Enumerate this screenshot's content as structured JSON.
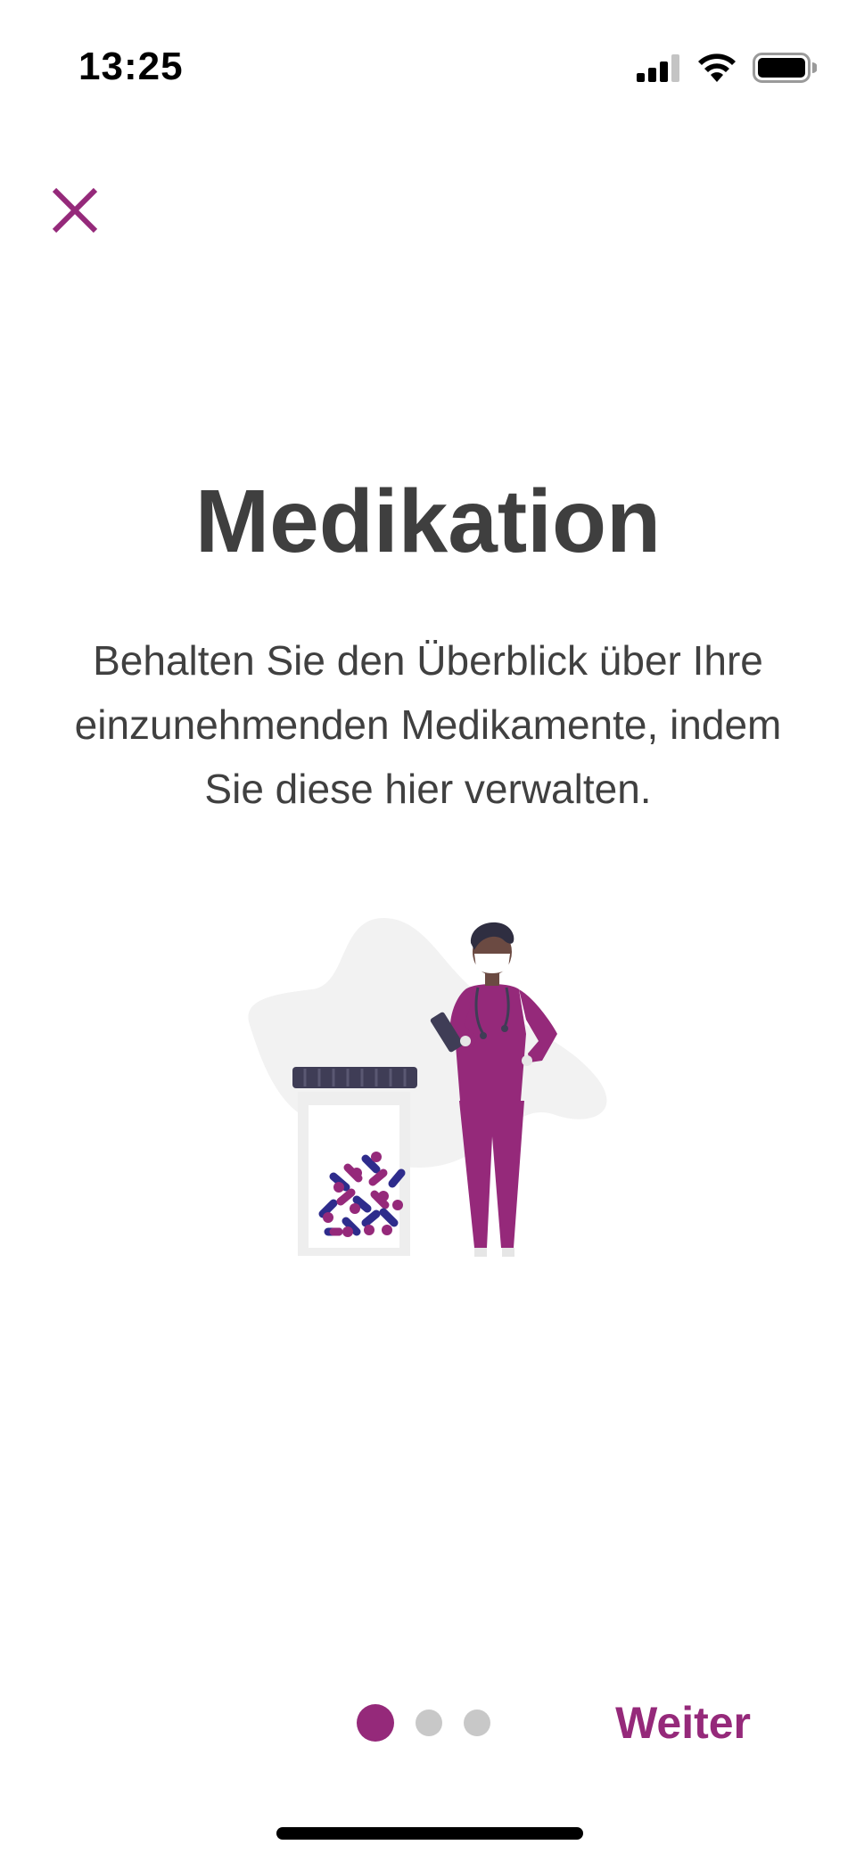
{
  "status_bar": {
    "time": "13:25"
  },
  "onboarding": {
    "title": "Medikation",
    "description": "Behalten Sie den Überblick über Ihre einzunehmenden Medikamente, indem Sie diese hier verwalten.",
    "next_label": "Weiter",
    "page_current": 1,
    "page_total": 3
  },
  "colors": {
    "accent": "#95297a",
    "text": "#404040",
    "dot_inactive": "#c8c8c8"
  },
  "icons": {
    "close": "close-icon",
    "signal": "cellular-signal-icon",
    "wifi": "wifi-icon",
    "battery": "battery-icon"
  }
}
